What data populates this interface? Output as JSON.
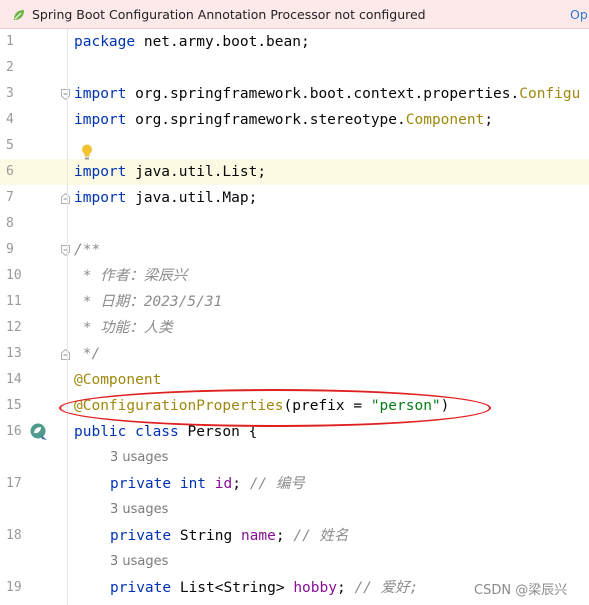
{
  "banner": {
    "message": "Spring Boot Configuration Annotation Processor not configured",
    "action": "Op",
    "icon": "spring-leaf-icon",
    "background": "#fde9ea"
  },
  "editor": {
    "line_numbers": [
      "1",
      "2",
      "3",
      "4",
      "5",
      "6",
      "7",
      "8",
      "9",
      "10",
      "11",
      "12",
      "13",
      "14",
      "15",
      "16",
      "",
      "17",
      "",
      "18",
      "",
      "19"
    ],
    "usages_label": "3 usages",
    "lines": {
      "l1": {
        "kw": "package",
        "rest": " net.army.boot.bean;"
      },
      "l3": {
        "kw": "import",
        "rest": " org.springframework.boot.context.properties.",
        "cls": "Configu"
      },
      "l4": {
        "kw": "import",
        "rest": " org.springframework.stereotype.",
        "cls": "Component",
        "end": ";"
      },
      "l6": {
        "kw": "import",
        "rest": " java.util.List;"
      },
      "l7": {
        "kw": "import",
        "rest": " java.util.Map;"
      },
      "l9": {
        "cmt": "/**"
      },
      "l10": {
        "cmt": " * 作者：梁辰兴"
      },
      "l11": {
        "cmt": " * 日期：2023/5/31"
      },
      "l12": {
        "cmt": " * 功能：人类"
      },
      "l13": {
        "cmt": " */"
      },
      "l14": {
        "ann": "@Component"
      },
      "l15": {
        "ann": "@ConfigurationProperties",
        "open": "(prefix = ",
        "str": "\"person\"",
        "close": ")"
      },
      "l16": {
        "kw": "public class",
        "rest": " Person {"
      },
      "l17": {
        "kw": "private int",
        "sp": " ",
        "fld": "id",
        "end": "; ",
        "cmt": "// 编号"
      },
      "l18": {
        "kw": "private",
        "type": " String ",
        "fld": "name",
        "end": "; ",
        "cmt": "// 姓名"
      },
      "l19": {
        "kw": "private",
        "type": " List<String> ",
        "fld": "hobby",
        "end": "; ",
        "cmt": "// 爱好;"
      }
    }
  },
  "colors": {
    "keyword": "#0033b3",
    "string": "#067d17",
    "annotation": "#9e880d",
    "field": "#871094",
    "comment": "#8c8c8c",
    "highlight": "#fcfae3",
    "ellipse": "#e02020"
  },
  "icons": [
    "spring-leaf-icon",
    "bulb-icon",
    "spring-bean-icon",
    "fold-icon"
  ],
  "watermark": "CSDN @梁辰兴"
}
